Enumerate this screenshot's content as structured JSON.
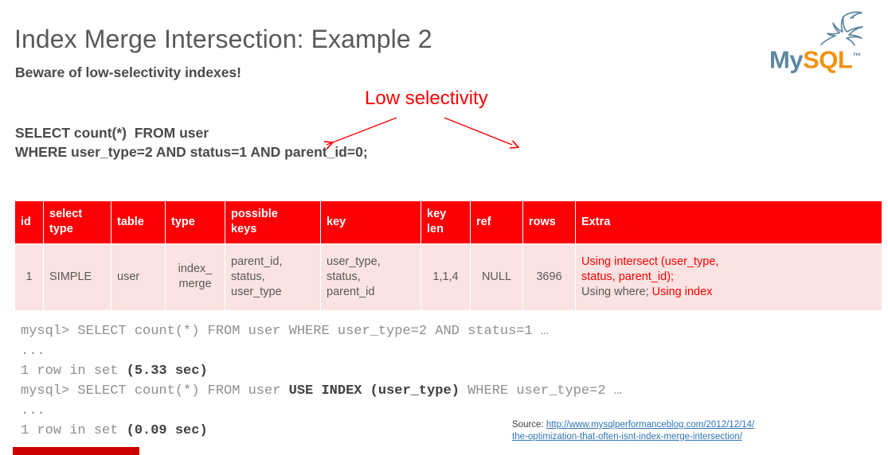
{
  "slide": {
    "title": "Index Merge Intersection: Example 2",
    "subtitle": "Beware of low-selectivity indexes!",
    "annotation": "Low selectivity",
    "query_line1": "SELECT count(*)  FROM user",
    "query_line2": "WHERE user_type=2 AND status=1 AND parent_id=0;"
  },
  "colors": {
    "title_gray": "#595959",
    "accent_red": "#ff0000",
    "table_header_red": "#fb0006",
    "table_row_pink": "#fae3e2",
    "link_blue": "#2e74b5",
    "bottom_bar_red": "#cc0000",
    "mysql_blue": "#5d87a1",
    "mysql_orange": "#f29111"
  },
  "explain_table": {
    "headers": [
      "id",
      "select\ntype",
      "table",
      "type",
      "possible\nkeys",
      "key",
      "key\nlen",
      "ref",
      "rows",
      "Extra"
    ],
    "rows": [
      {
        "id": "1",
        "select_type": "SIMPLE",
        "table": "user",
        "type": "index_\nmerge",
        "possible_keys": "parent_id,\nstatus,\nuser_type",
        "key": "user_type,\nstatus,\nparent_id",
        "key_len": "1,1,4",
        "ref": "NULL",
        "rows": "3696",
        "extra_red_1": "Using intersect (user_type,",
        "extra_red_2": "status, parent_id);",
        "extra_gray_3": "Using where; ",
        "extra_red_3": "Using index"
      }
    ]
  },
  "console": {
    "line1_prompt": "mysql> SELECT count(*) FROM user WHERE user_type=2 AND status=1 …",
    "line2_dots": "...",
    "line3_a": "1 row in set ",
    "line3_b": "(5.33 sec)",
    "line4_a": "mysql> SELECT count(*) FROM user ",
    "line4_b": "USE INDEX (user_type)",
    "line4_c": " WHERE user_type=2 …",
    "line5_dots": "...",
    "line6_a": "1 row in set ",
    "line6_b": "(0.09 sec)"
  },
  "source": {
    "label": "Source: ",
    "url_line1": "http://www.mysqlperformanceblog.com/2012/12/14/",
    "url_line2": "the-optimization-that-often-isnt-index-merge-intersection/"
  },
  "logo": {
    "word_my": "My",
    "word_sql": "SQL",
    "word_tm": "™"
  }
}
